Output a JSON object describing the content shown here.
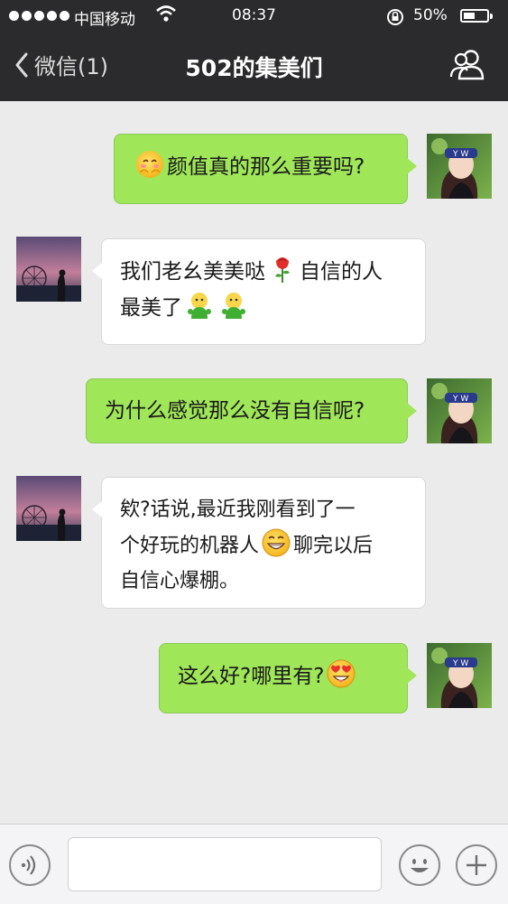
{
  "status_bar": {
    "carrier": "中国移动",
    "time": "08:37",
    "battery_percent_text": "50%",
    "battery_level": 0.5
  },
  "nav": {
    "back_label": "微信(1)",
    "title": "502的集美们",
    "group_icon": "group-members-icon"
  },
  "messages": [
    {
      "side": "out",
      "text": "颜值真的那么重要吗?",
      "emoji_before": "shy-face"
    },
    {
      "side": "in",
      "line1": "我们老幺美美哒",
      "line1b": "自信的人",
      "line2": "最美了",
      "emoji": [
        "rose",
        "doll",
        "doll"
      ]
    },
    {
      "side": "out",
      "text": "为什么感觉那么没有自信呢?"
    },
    {
      "side": "in",
      "line1": "欸?话说,最近我刚看到了一",
      "line2": "个好玩的机器人",
      "line2b": "聊完以后",
      "line3": "自信心爆棚。",
      "emoji": [
        "grin"
      ]
    },
    {
      "side": "out",
      "text": "这么好?哪里有?",
      "emoji_after": "heart-eyes"
    }
  ],
  "input_bar": {
    "voice_icon": "voice-icon",
    "emoji_icon": "emoji-icon",
    "plus_icon": "plus-icon",
    "text_value": ""
  },
  "colors": {
    "header_bg": "#2b2b2d",
    "chat_bg": "#ebebeb",
    "outgoing_bubble": "#9fe658",
    "incoming_bubble": "#ffffff"
  }
}
